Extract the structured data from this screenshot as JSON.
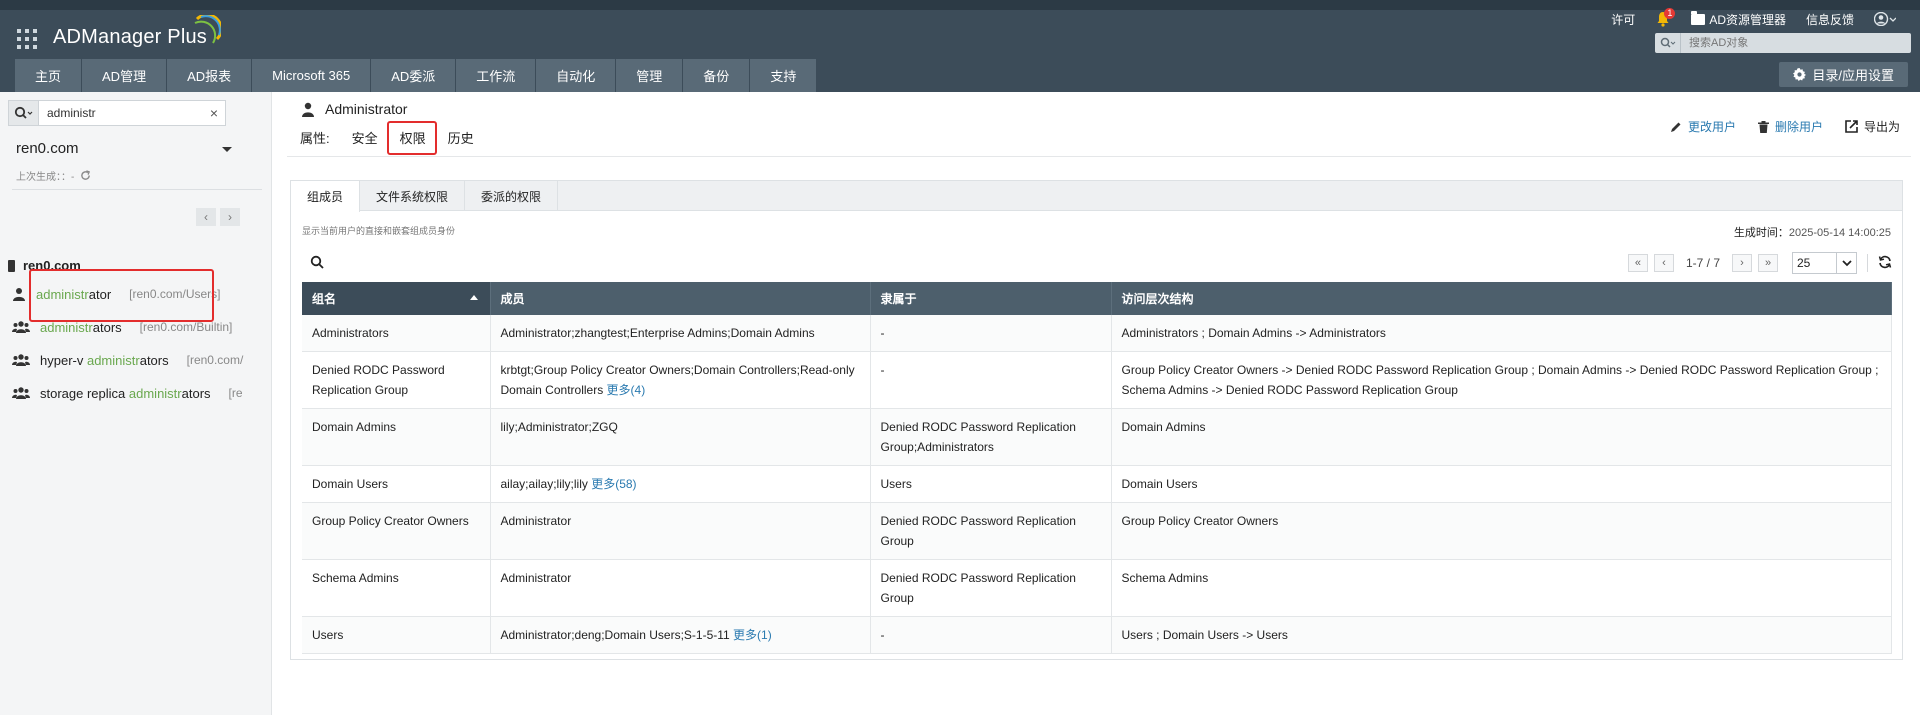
{
  "header": {
    "brand": "ADManager Plus",
    "links": {
      "license": "许可",
      "notifications_count": "1",
      "ad_explorer": "AD资源管理器",
      "feedback": "信息反馈"
    },
    "search_placeholder": "搜索AD对象",
    "nav": [
      "主页",
      "AD管理",
      "AD报表",
      "Microsoft 365",
      "AD委派",
      "工作流",
      "自动化",
      "管理",
      "备份",
      "支持"
    ],
    "settings_label": "目录/应用设置"
  },
  "sidebar": {
    "search_value": "administr",
    "domain": "ren0.com",
    "last_generated_label": "上次生成：：-",
    "tree_root": "ren0.com",
    "results": [
      {
        "pre": "",
        "match": "administr",
        "post": "ator",
        "path": "[ren0.com/Users]",
        "type": "user"
      },
      {
        "pre": "",
        "match": "administr",
        "post": "ators",
        "path": "[ren0.com/Builtin]",
        "type": "group"
      },
      {
        "pre": "hyper-v ",
        "match": "administr",
        "post": "ators",
        "path": "[ren0.com/",
        "type": "group"
      },
      {
        "pre": "storage replica ",
        "match": "administr",
        "post": "ators",
        "path": "[re",
        "type": "group"
      }
    ]
  },
  "main": {
    "object_name": "Administrator",
    "prop_label": "属性:",
    "prop_tabs": [
      "安全",
      "权限",
      "历史"
    ],
    "active_prop_tab": "权限",
    "actions": {
      "modify": "更改用户",
      "delete": "删除用户",
      "export": "导出为"
    },
    "sub_tabs": [
      "组成员",
      "文件系统权限",
      "委派的权限"
    ],
    "description": "显示当前用户的直接和嵌套组成员身份",
    "gen_time_label": "生成时间：",
    "gen_time_value": "2025-05-14 14:00:25",
    "pager_info": "1-7 / 7",
    "page_size": "25",
    "columns": [
      "组名",
      "成员",
      "隶属于",
      "访问层次结构"
    ],
    "rows": [
      {
        "group": "Administrators",
        "members": "Administrator;zhangtest;Enterprise Admins;Domain Admins",
        "more": "",
        "member_of": "-",
        "hierarchy": "Administrators ; Domain Admins -> Administrators"
      },
      {
        "group": "Denied RODC Password Replication Group",
        "members": "krbtgt;Group Policy Creator Owners;Domain Controllers;Read-only Domain Controllers",
        "more": "更多(4)",
        "member_of": "-",
        "hierarchy": "Group Policy Creator Owners -> Denied RODC Password Replication Group ; Domain Admins -> Denied RODC Password Replication Group ; Schema Admins -> Denied RODC Password Replication Group"
      },
      {
        "group": "Domain Admins",
        "members": "lily;Administrator;ZGQ",
        "more": "",
        "member_of": "Denied RODC Password Replication Group;Administrators",
        "hierarchy": "Domain Admins"
      },
      {
        "group": "Domain Users",
        "members": "ailay;ailay;lily;lily",
        "more": "更多(58)",
        "member_of": "Users",
        "hierarchy": "Domain Users"
      },
      {
        "group": "Group Policy Creator Owners",
        "members": "Administrator",
        "more": "",
        "member_of": "Denied RODC Password Replication Group",
        "hierarchy": "Group Policy Creator Owners"
      },
      {
        "group": "Schema Admins",
        "members": "Administrator",
        "more": "",
        "member_of": "Denied RODC Password Replication Group",
        "hierarchy": "Schema Admins"
      },
      {
        "group": "Users",
        "members": "Administrator;deng;Domain Users;S-1-5-11",
        "more": "更多(1)",
        "member_of": "-",
        "hierarchy": "Users ; Domain Users -> Users"
      }
    ]
  },
  "colors": {
    "header_bg": "#3c4c59",
    "nav_bg": "#596a77",
    "table_header": "#4d5f6c",
    "match_highlight": "#6aa84f",
    "annotation_red": "#e32d2d",
    "link_blue": "#2a7ab0"
  }
}
